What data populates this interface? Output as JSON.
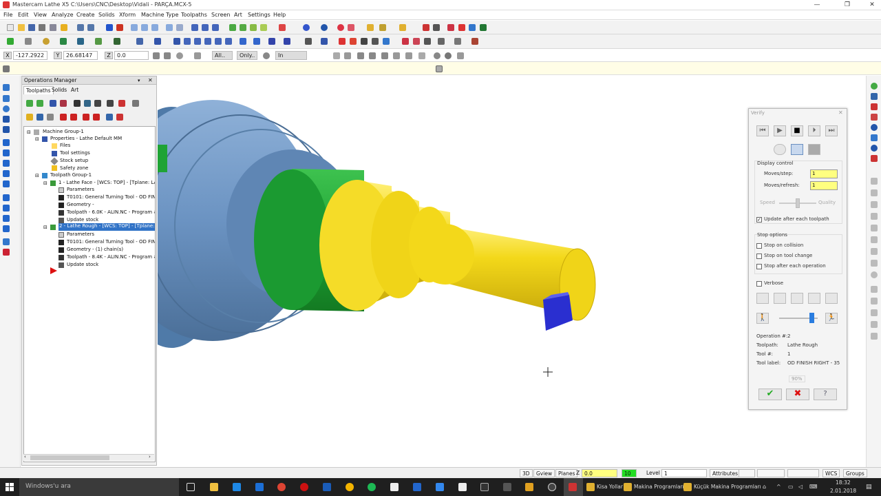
{
  "window": {
    "title": "Mastercam Lathe X5  C:\\Users\\CNC\\Desktop\\Vidali - PARÇA.MCX-5",
    "min": "—",
    "max": "❐",
    "close": "✕"
  },
  "menu": [
    "File",
    "Edit",
    "View",
    "Analyze",
    "Create",
    "Solids",
    "Xform",
    "Machine Type",
    "Toolpaths",
    "Screen",
    "Art",
    "Settings",
    "Help"
  ],
  "coords": {
    "x_label": "X",
    "x": "-127.2922",
    "y_label": "Y",
    "y": "26.68147",
    "z_label": "Z",
    "z": "0.0",
    "all": "All..",
    "only": "Only..",
    "in": "In"
  },
  "ops": {
    "title": "Operations Manager",
    "tabs": [
      "Toolpaths",
      "Solids",
      "Art"
    ],
    "tree": [
      "Machine Group-1",
      "Properties - Lathe Default MM",
      "Files",
      "Tool settings",
      "Stock setup",
      "Safety zone",
      "Toolpath Group-1",
      "1 - Lathe Face - [WCS: TOP] - [Tplane: LA",
      "Parameters",
      "T0101: General Turning Tool - OD FINI",
      "Geometry -",
      "Toolpath - 6.0K - ALIN.NC - Program #",
      "Update stock",
      "2 - Lathe Rough - [WCS: TOP] - [Tplane: L",
      "Parameters",
      "T0101: General Turning Tool - OD FINI",
      "Geometry - (1) chain(s)",
      "Toolpath - 8.4K - ALIN.NC - Program #",
      "Update stock"
    ]
  },
  "verify": {
    "title": "Verify",
    "display_control": "Display control",
    "moves_step_label": "Moves/step:",
    "moves_step": "1",
    "moves_refresh_label": "Moves/refresh:",
    "moves_refresh": "1",
    "speed": "Speed",
    "quality": "Quality",
    "update_after": "Update after each toolpath",
    "stop_options": "Stop options",
    "stop_collision": "Stop on collision",
    "stop_tool_change": "Stop on tool change",
    "stop_after_op": "Stop after each operation",
    "verbose": "Verbose",
    "info": [
      {
        "k": "Operation #:",
        "v": "2"
      },
      {
        "k": "Toolpath:",
        "v": "Lathe Rough"
      },
      {
        "k": "Tool #:",
        "v": "1"
      },
      {
        "k": "Tool label:",
        "v": "OD FINISH RIGHT - 35"
      }
    ],
    "percent": "90%"
  },
  "status": {
    "b3d": "3D",
    "gview": "Gview",
    "planes": "Planes",
    "z": "Z",
    "z_val": "0.0",
    "color": "10",
    "level_label": "Level",
    "level": "1",
    "attributes": "Attributes",
    "wcs": "WCS",
    "groups": "Groups"
  },
  "taskbar": {
    "search": "Windows'u ara",
    "items": [
      "Kisa Yollar",
      "Makina Programları",
      "Küçük Makina Programları"
    ],
    "time": "18:32",
    "date": "2.01.2018"
  },
  "colors": {
    "chuck": "#6b93c2",
    "green": "#1fa335",
    "yellow": "#f2d81a",
    "insert": "#2a2fd0",
    "selection": "#3173c7"
  }
}
